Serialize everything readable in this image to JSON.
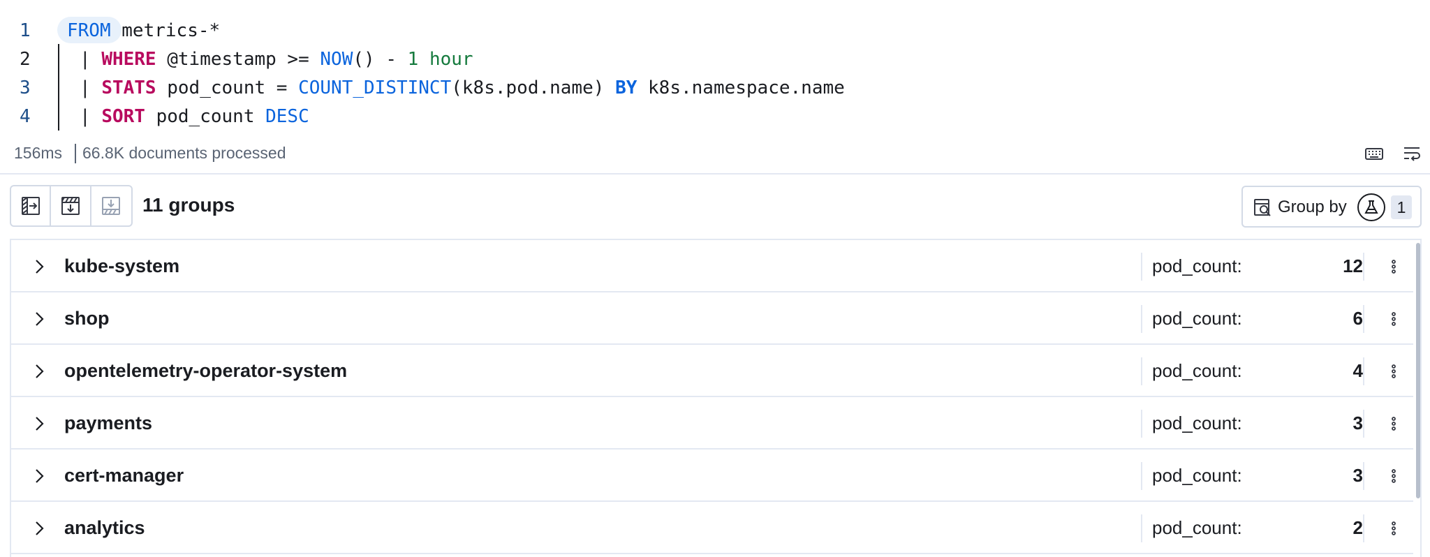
{
  "editor": {
    "lines": [
      {
        "number": "1",
        "tokens": [
          {
            "t": "FROM",
            "c": "kw-blue"
          },
          {
            "t": " metrics-*",
            "c": "txt"
          }
        ]
      },
      {
        "number": "2",
        "tokens": [
          {
            "t": "| ",
            "c": "txt"
          },
          {
            "t": "WHERE",
            "c": "kw-pink"
          },
          {
            "t": " @timestamp >= ",
            "c": "txt"
          },
          {
            "t": "NOW",
            "c": "kw-blue"
          },
          {
            "t": "() - ",
            "c": "txt"
          },
          {
            "t": "1 hour",
            "c": "num"
          }
        ]
      },
      {
        "number": "3",
        "tokens": [
          {
            "t": "| ",
            "c": "txt"
          },
          {
            "t": "STATS",
            "c": "kw-pink"
          },
          {
            "t": " pod_count = ",
            "c": "txt"
          },
          {
            "t": "COUNT_DISTINCT",
            "c": "kw-blue"
          },
          {
            "t": "(k8s.pod.name) ",
            "c": "txt"
          },
          {
            "t": "BY",
            "c": "kw-bold"
          },
          {
            "t": " k8s.namespace.name",
            "c": "txt"
          }
        ]
      },
      {
        "number": "4",
        "tokens": [
          {
            "t": "| ",
            "c": "txt"
          },
          {
            "t": "SORT",
            "c": "kw-pink"
          },
          {
            "t": " pod_count ",
            "c": "txt"
          },
          {
            "t": "DESC",
            "c": "kw-blue"
          }
        ]
      }
    ]
  },
  "status": {
    "duration": "156ms",
    "documents": "66.8K documents processed"
  },
  "toolbar": {
    "groups_count": "11 groups",
    "group_by_label": "Group by",
    "group_by_count": "1"
  },
  "groups": [
    {
      "name": "kube-system",
      "metric_label": "pod_count:",
      "value": "12"
    },
    {
      "name": "shop",
      "metric_label": "pod_count:",
      "value": "6"
    },
    {
      "name": "opentelemetry-operator-system",
      "metric_label": "pod_count:",
      "value": "4"
    },
    {
      "name": "payments",
      "metric_label": "pod_count:",
      "value": "3"
    },
    {
      "name": "cert-manager",
      "metric_label": "pod_count:",
      "value": "3"
    },
    {
      "name": "analytics",
      "metric_label": "pod_count:",
      "value": "2"
    }
  ],
  "colors": {
    "keyword_blue": "#0b64dd",
    "keyword_pink": "#b80a5e",
    "number_green": "#157a3d",
    "border": "#e3e8f2"
  }
}
